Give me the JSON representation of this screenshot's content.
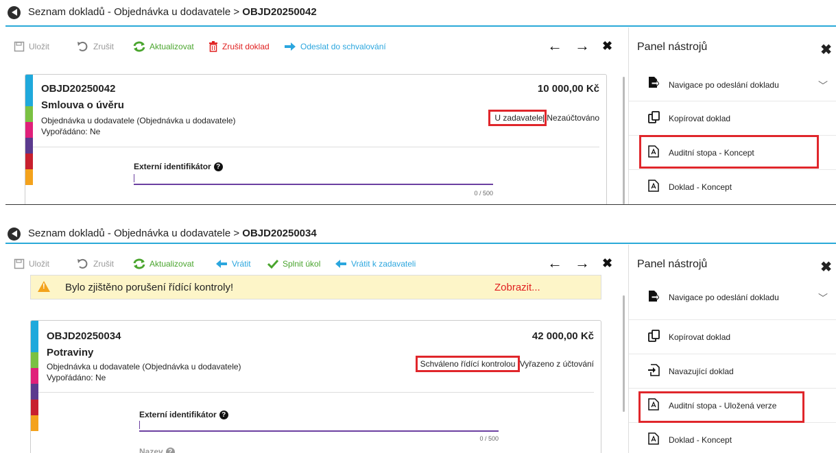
{
  "screen1": {
    "breadcrumb_prefix": "Seznam dokladů - Objednávka u dodavatele >",
    "breadcrumb_doc": "OBJD20250042",
    "toolbar": {
      "save": "Uložit",
      "cancel": "Zrušit",
      "refresh": "Aktualizovat",
      "delete_doc": "Zrušit doklad",
      "send_approval": "Odeslat do schvalování"
    },
    "card": {
      "doc_no": "OBJD20250042",
      "amount": "10 000,00 Kč",
      "name": "Smlouva o úvěru",
      "type": "Objednávka u dodavatele (Objednávka u dodavatele)",
      "settled": "Vypořádáno: Ne",
      "status_main": "U zadavatele",
      "status_sep": "|",
      "status_acc": "Nezaúčtováno",
      "field_label": "Externí identifikátor",
      "counter": "0 / 500"
    },
    "panel": {
      "title": "Panel nástrojů",
      "items": [
        "Navigace po odeslání dokladu",
        "Kopírovat doklad",
        "Auditní stopa - Koncept",
        "Doklad - Koncept"
      ]
    }
  },
  "screen2": {
    "breadcrumb_prefix": "Seznam dokladů - Objednávka u dodavatele >",
    "breadcrumb_doc": "OBJD20250034",
    "toolbar": {
      "save": "Uložit",
      "cancel": "Zrušit",
      "refresh": "Aktualizovat",
      "return": "Vrátit",
      "complete_task": "Splnit úkol",
      "return_to_submitter": "Vrátit k zadavateli"
    },
    "warning": {
      "text": "Bylo zjištěno porušení řídící kontroly!",
      "link": "Zobrazit..."
    },
    "card": {
      "doc_no": "OBJD20250034",
      "amount": "42 000,00 Kč",
      "name": "Potraviny",
      "type": "Objednávka u dodavatele (Objednávka u dodavatele)",
      "settled": "Vypořádáno: Ne",
      "status_main": "Schváleno řídící kontrolou",
      "status_acc": "Vyřazeno z účtování",
      "field_label": "Externí identifikátor",
      "counter": "0 / 500",
      "field2_label": "Nazev"
    },
    "panel": {
      "title": "Panel nástrojů",
      "items": [
        "Navigace po odeslání dokladu",
        "Kopírovat doklad",
        "Navazující doklad",
        "Auditní stopa - Uložená verze",
        "Doklad - Koncept"
      ]
    }
  },
  "colors": {
    "accent": "#29a9d8",
    "green": "#4aa52e",
    "red": "#e02020",
    "highlight": "#e0262b",
    "stripes": [
      "#1fa9dc",
      "#1fa9dc",
      "#7ac142",
      "#e0207a",
      "#5b3a8e",
      "#c8202e",
      "#f4a21c"
    ]
  }
}
